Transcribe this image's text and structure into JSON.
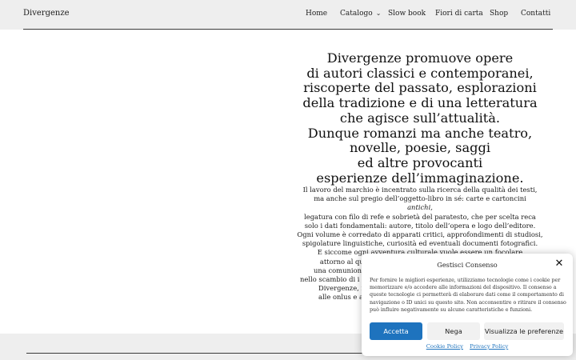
{
  "header": {
    "site_title": "Divergenze",
    "nav": [
      {
        "label": "Home"
      },
      {
        "label": "Catalogo",
        "has_dropdown": true
      },
      {
        "label": "Slow book"
      },
      {
        "label": "Fiori di carta"
      },
      {
        "label": "Shop"
      },
      {
        "label": "Contatti"
      }
    ]
  },
  "main": {
    "headline_lines": [
      "Divergenze promuove opere",
      "di autori classici e contemporanei,",
      "riscoperte del passato, esplorazioni",
      "della tradizione e di una letteratura",
      "che agisce sull’attualità.",
      "Dunque romanzi ma anche teatro,",
      "novelle, poesie, saggi",
      "ed altre provocanti",
      "esperienze dell’immaginazione."
    ],
    "body_lines": [
      "Il lavoro del marchio è incentrato sulla ricerca della qualità dei testi,",
      "ma anche sul pregio dell’oggetto-libro in sé: carte e cartoncini",
      "antichi,",
      "legatura con filo di refe e sobrietà del paratesto, che per scelta reca",
      "solo i dati fondamentali: autore, titolo dell’opera e logo dell’editore.",
      "Ogni volume è corredato di apparati critici, approfondimenti di studiosi,",
      "spigolature linguistiche, curiosità ed eventuali documenti fotografici.",
      "E siccome ogni avventura culturale vuole essere un focolare",
      "attorno al quale trascorrere ore felici, ci piace immaginare",
      "una comunion",
      "nello scambio di i",
      "Divergenze, in",
      "alle onlus e a"
    ]
  },
  "consent": {
    "title": "Gestisci Consenso",
    "text": "Per fornire le migliori esperienze, utilizziamo tecnologie come i cookie per memorizzare e/o accedere alle informazioni del dispositivo. Il consenso a queste tecnologie ci permetterà di elaborare dati come il comportamento di navigazione o ID unici su questo sito. Non acconsentire o ritirare il consenso può influire negativamente su alcune caratteristiche e funzioni.",
    "accept_label": "Accetta",
    "deny_label": "Nega",
    "prefs_label": "Visualizza le preferenze",
    "cookie_policy_label": "Cookie Policy",
    "privacy_policy_label": "Privacy Policy",
    "close_icon": "close-icon",
    "accent_color": "#1e73be"
  }
}
